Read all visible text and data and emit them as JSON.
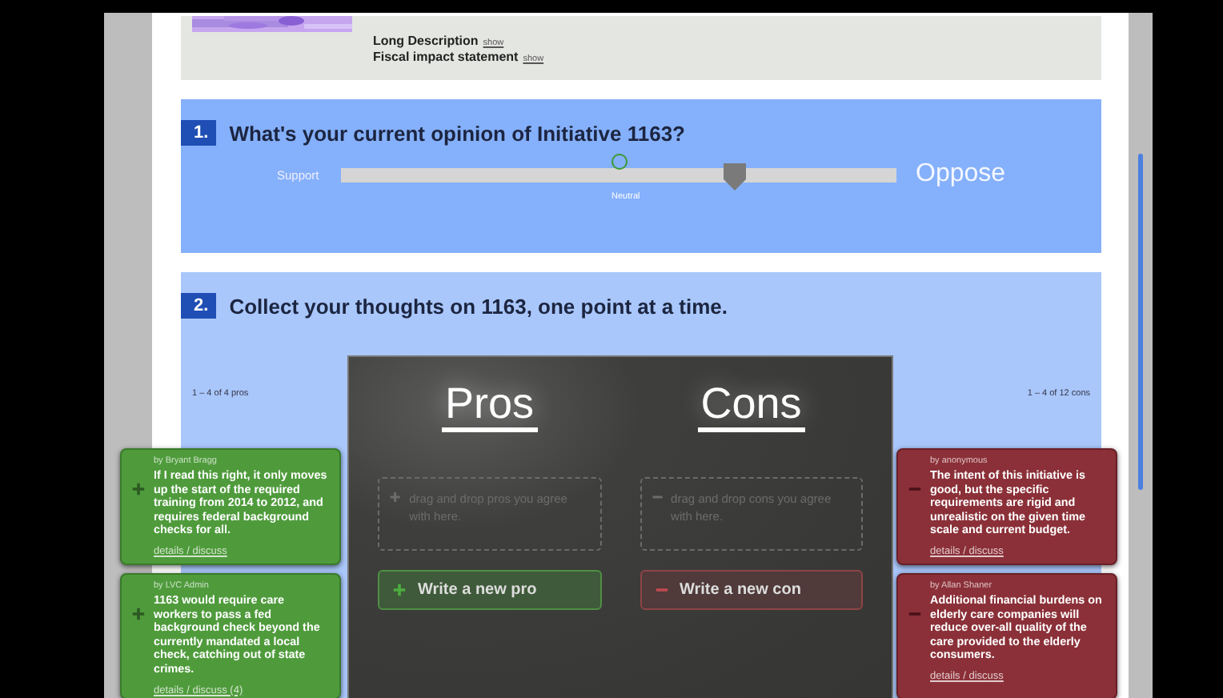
{
  "details": {
    "links": [
      {
        "label": "Long Description",
        "action": "show"
      },
      {
        "label": "Fiscal impact statement",
        "action": "show"
      }
    ]
  },
  "question1": {
    "number": "1.",
    "text": "What's your current opinion of Initiative 1163?",
    "left_label": "Support",
    "right_label": "Oppose",
    "center_label": "Neutral",
    "level": 0.71
  },
  "question2": {
    "number": "2.",
    "text": "Collect your thoughts on 1163, one point at a time.",
    "pros_count": "1 – 4 of 4 pros",
    "cons_count": "1 – 4 of 12 cons"
  },
  "board": {
    "columns": [
      {
        "kind": "pro",
        "heading": "Pros",
        "drop_hint": "drag and drop pros you agree with here.",
        "button": "Write a new pro"
      },
      {
        "kind": "con",
        "heading": "Cons",
        "drop_hint": "drag and drop cons you agree with here.",
        "button": "Write a new con"
      }
    ]
  },
  "pros": [
    {
      "author": "by Bryant Bragg",
      "text": "If I read this right, it only moves up the start of the required training from 2014 to 2012, and requires federal background checks for all.",
      "links": "details / discuss"
    },
    {
      "author": "by LVC Admin",
      "text": "1163 would require care workers to pass a fed background check beyond the currently mandated a local check, catching out of state crimes.",
      "links": "details / discuss (4)"
    }
  ],
  "cons": [
    {
      "author": "by anonymous",
      "text": "The intent of this initiative is good, but the specific requirements are rigid and unrealistic on the given time scale and current budget.",
      "links": "details / discuss"
    },
    {
      "author": "by Allan Shaner",
      "text": "Additional financial burdens on elderly care companies will reduce over-all quality of the care provided to the elderly consumers.",
      "links": "details / discuss"
    }
  ]
}
